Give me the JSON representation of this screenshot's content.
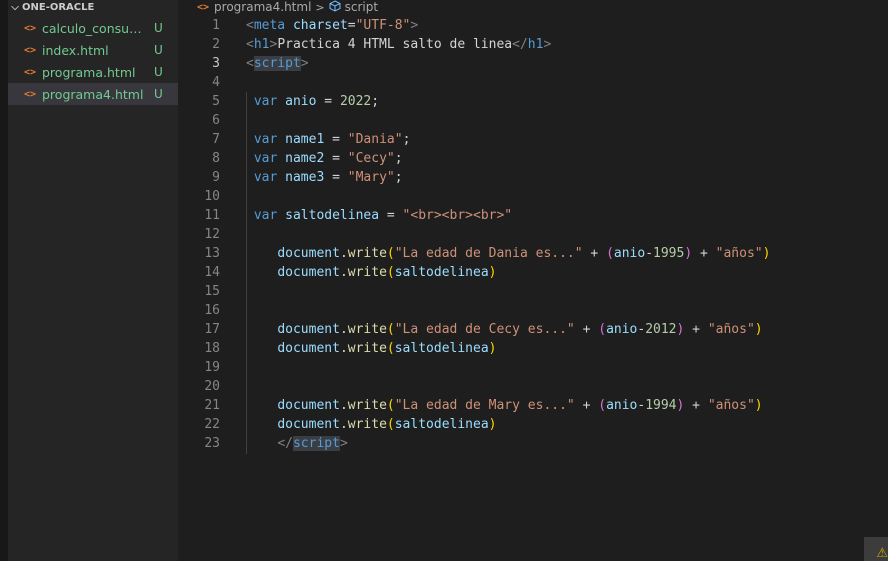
{
  "explorer": {
    "chevron": "chevron-down-icon",
    "title": "ONE-ORACLE",
    "files": [
      {
        "name": "calculo_consum...",
        "status": "U",
        "selected": false,
        "icon": "html-icon"
      },
      {
        "name": "index.html",
        "status": "U",
        "selected": false,
        "icon": "html-icon"
      },
      {
        "name": "programa.html",
        "status": "U",
        "selected": false,
        "icon": "html-icon"
      },
      {
        "name": "programa4.html",
        "status": "U",
        "selected": true,
        "icon": "html-icon"
      }
    ],
    "file_icon_glyph": "<>"
  },
  "breadcrumb": {
    "file": "programa4.html",
    "separator": ">",
    "symbol": "script",
    "file_icon": "html-icon",
    "symbol_icon": "cube-icon"
  },
  "editor": {
    "current_line": 3,
    "lines": [
      {
        "n": "1",
        "tokens": [
          [
            "punc",
            "<"
          ],
          [
            "tag",
            "meta"
          ],
          [
            "text",
            " "
          ],
          [
            "attr",
            "charset"
          ],
          [
            "op",
            "="
          ],
          [
            "str",
            "\"UTF-8\""
          ],
          [
            "punc",
            ">"
          ]
        ]
      },
      {
        "n": "2",
        "tokens": [
          [
            "punc",
            "<"
          ],
          [
            "tag",
            "h1"
          ],
          [
            "punc",
            ">"
          ],
          [
            "text",
            "Practica 4 HTML salto de linea"
          ],
          [
            "punc",
            "</"
          ],
          [
            "tag",
            "h1"
          ],
          [
            "punc",
            ">"
          ]
        ]
      },
      {
        "n": "3",
        "tokens": [
          [
            "punc",
            "<"
          ],
          [
            "taghl",
            "script"
          ],
          [
            "punc",
            ">"
          ]
        ]
      },
      {
        "n": "4",
        "tokens": []
      },
      {
        "n": "5",
        "tokens": [
          [
            "text",
            " "
          ],
          [
            "kw",
            "var"
          ],
          [
            "text",
            " "
          ],
          [
            "var",
            "anio"
          ],
          [
            "op",
            " = "
          ],
          [
            "num",
            "2022"
          ],
          [
            "op",
            ";"
          ]
        ]
      },
      {
        "n": "6",
        "tokens": []
      },
      {
        "n": "7",
        "tokens": [
          [
            "text",
            " "
          ],
          [
            "kw",
            "var"
          ],
          [
            "text",
            " "
          ],
          [
            "var",
            "name1"
          ],
          [
            "op",
            " = "
          ],
          [
            "str",
            "\"Dania\""
          ],
          [
            "op",
            ";"
          ]
        ]
      },
      {
        "n": "8",
        "tokens": [
          [
            "text",
            " "
          ],
          [
            "kw",
            "var"
          ],
          [
            "text",
            " "
          ],
          [
            "var",
            "name2"
          ],
          [
            "op",
            " = "
          ],
          [
            "str",
            "\"Cecy\""
          ],
          [
            "op",
            ";"
          ]
        ]
      },
      {
        "n": "9",
        "tokens": [
          [
            "text",
            " "
          ],
          [
            "kw",
            "var"
          ],
          [
            "text",
            " "
          ],
          [
            "var",
            "name3"
          ],
          [
            "op",
            " = "
          ],
          [
            "str",
            "\"Mary\""
          ],
          [
            "op",
            ";"
          ]
        ]
      },
      {
        "n": "10",
        "tokens": []
      },
      {
        "n": "11",
        "tokens": [
          [
            "text",
            " "
          ],
          [
            "kw",
            "var"
          ],
          [
            "text",
            " "
          ],
          [
            "var",
            "saltodelinea"
          ],
          [
            "op",
            " = "
          ],
          [
            "str",
            "\"<br><br><br>\""
          ]
        ]
      },
      {
        "n": "12",
        "tokens": []
      },
      {
        "n": "13",
        "tokens": [
          [
            "text",
            "    "
          ],
          [
            "var",
            "document"
          ],
          [
            "op",
            "."
          ],
          [
            "fn",
            "write"
          ],
          [
            "br1",
            "("
          ],
          [
            "str",
            "\"La edad de Dania es...\""
          ],
          [
            "op",
            " + "
          ],
          [
            "br2",
            "("
          ],
          [
            "var",
            "anio"
          ],
          [
            "op",
            "-"
          ],
          [
            "num",
            "1995"
          ],
          [
            "br2",
            ")"
          ],
          [
            "op",
            " + "
          ],
          [
            "str",
            "\"años\""
          ],
          [
            "br1",
            ")"
          ]
        ]
      },
      {
        "n": "14",
        "tokens": [
          [
            "text",
            "    "
          ],
          [
            "var",
            "document"
          ],
          [
            "op",
            "."
          ],
          [
            "fn",
            "write"
          ],
          [
            "br1",
            "("
          ],
          [
            "var",
            "saltodelinea"
          ],
          [
            "br1",
            ")"
          ]
        ]
      },
      {
        "n": "15",
        "tokens": []
      },
      {
        "n": "16",
        "tokens": []
      },
      {
        "n": "17",
        "tokens": [
          [
            "text",
            "    "
          ],
          [
            "var",
            "document"
          ],
          [
            "op",
            "."
          ],
          [
            "fn",
            "write"
          ],
          [
            "br1",
            "("
          ],
          [
            "str",
            "\"La edad de Cecy es...\""
          ],
          [
            "op",
            " + "
          ],
          [
            "br2",
            "("
          ],
          [
            "var",
            "anio"
          ],
          [
            "op",
            "-"
          ],
          [
            "num",
            "2012"
          ],
          [
            "br2",
            ")"
          ],
          [
            "op",
            " + "
          ],
          [
            "str",
            "\"años\""
          ],
          [
            "br1",
            ")"
          ]
        ]
      },
      {
        "n": "18",
        "tokens": [
          [
            "text",
            "    "
          ],
          [
            "var",
            "document"
          ],
          [
            "op",
            "."
          ],
          [
            "fn",
            "write"
          ],
          [
            "br1",
            "("
          ],
          [
            "var",
            "saltodelinea"
          ],
          [
            "br1",
            ")"
          ]
        ]
      },
      {
        "n": "19",
        "tokens": []
      },
      {
        "n": "20",
        "tokens": []
      },
      {
        "n": "21",
        "tokens": [
          [
            "text",
            "    "
          ],
          [
            "var",
            "document"
          ],
          [
            "op",
            "."
          ],
          [
            "fn",
            "write"
          ],
          [
            "br1",
            "("
          ],
          [
            "str",
            "\"La edad de Mary es...\""
          ],
          [
            "op",
            " + "
          ],
          [
            "br2",
            "("
          ],
          [
            "var",
            "anio"
          ],
          [
            "op",
            "-"
          ],
          [
            "num",
            "1994"
          ],
          [
            "br2",
            ")"
          ],
          [
            "op",
            " + "
          ],
          [
            "str",
            "\"años\""
          ],
          [
            "br1",
            ")"
          ]
        ]
      },
      {
        "n": "22",
        "tokens": [
          [
            "text",
            "    "
          ],
          [
            "var",
            "document"
          ],
          [
            "op",
            "."
          ],
          [
            "fn",
            "write"
          ],
          [
            "br1",
            "("
          ],
          [
            "var",
            "saltodelinea"
          ],
          [
            "br1",
            ")"
          ]
        ]
      },
      {
        "n": "23",
        "tokens": [
          [
            "text",
            "    "
          ],
          [
            "punc",
            "</"
          ],
          [
            "taghl",
            "script"
          ],
          [
            "punc",
            ">"
          ]
        ]
      }
    ]
  },
  "status": {
    "warning_icon": "warning-icon",
    "warning_glyph": "⚠"
  }
}
